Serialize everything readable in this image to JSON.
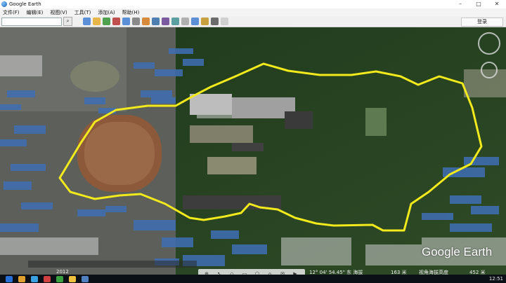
{
  "window": {
    "title": "Google Earth",
    "controls": [
      "–",
      "□",
      "✕"
    ]
  },
  "menu": {
    "items": [
      "文件(F)",
      "编辑(E)",
      "视图(V)",
      "工具(T)",
      "添加(A)",
      "帮助(H)"
    ]
  },
  "toolbar": {
    "login_label": "登录",
    "search_icon": "magnifier-icon",
    "tool_colors": [
      "#5b8fd6",
      "#e6b64a",
      "#4fa04f",
      "#c05050",
      "#5b8fd6",
      "#8a8a8a",
      "#d68b3b",
      "#4f7fb0",
      "#7b5aa0",
      "#5aa0a0",
      "#b0b0b0",
      "#5b8fd6",
      "#c9a040",
      "#6b6b6b",
      "#d0d0d0"
    ]
  },
  "map": {
    "watermark": "Google Earth",
    "year": "2012",
    "status": {
      "coords": "12° 04' 54.45\" 东  海拔",
      "elevation": "163 米",
      "eye_alt_label": "视角海拔高度",
      "eye_alt_value": "452 米"
    },
    "boundary_color": "#f2ea1c"
  },
  "navtool": {
    "labels": [
      "⊕",
      "↖",
      "◇",
      "▭",
      "⬠",
      "⌂",
      "✉",
      "▶"
    ]
  },
  "taskbar": {
    "time": "12:51",
    "colors": [
      "#2a6fd6",
      "#e0a030",
      "#3aa0e0",
      "#d04040",
      "#3aa040",
      "#f0c040",
      "#5080c0"
    ]
  }
}
